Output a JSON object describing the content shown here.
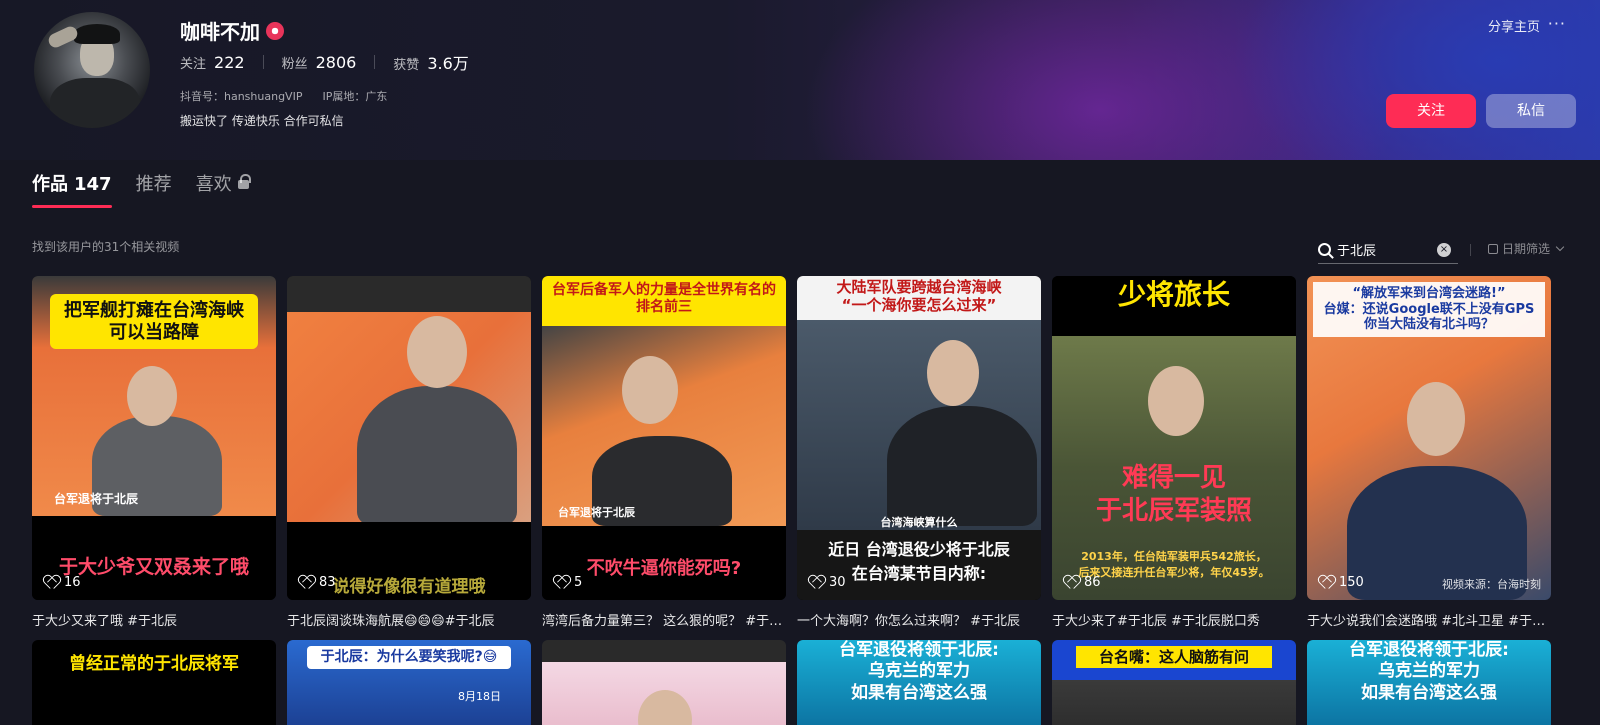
{
  "profile": {
    "name": "咖啡不加",
    "stats": [
      {
        "label": "关注",
        "value": "222"
      },
      {
        "label": "粉丝",
        "value": "2806"
      },
      {
        "label": "获赞",
        "value": "3.6万"
      }
    ],
    "douyin_id": "抖音号：hanshuangVIP",
    "ip": "IP属地：广东",
    "bio": "搬运快了 传递快乐 合作可私信",
    "share_label": "分享主页",
    "more_label": "···",
    "follow_label": "关注",
    "message_label": "私信"
  },
  "tabs": [
    {
      "label": "作品",
      "count": "147"
    },
    {
      "label": "推荐"
    },
    {
      "label": "喜欢"
    }
  ],
  "results_info": "找到该用户的31个相关视频",
  "search": {
    "value": "于北辰",
    "clear": "×"
  },
  "date_filter": "日期筛选",
  "videos": [
    {
      "top": "把军舰打瘫在台湾海峡\n可以当路障",
      "mid": "台军退将于北辰",
      "bottom": "于大少爷又双叒来了哦",
      "likes": "16",
      "title": "于大少又来了哦 #于北辰"
    },
    {
      "top": "",
      "mid": "",
      "bottom": "说得好像很有道理哦",
      "likes": "83",
      "title": "于北辰阔谈珠海航展😄😄😄#于北辰"
    },
    {
      "top": "台军后备军人的力量是全世界有名的\n排名前三",
      "mid": "台军退将于北辰",
      "bottom": "不吹牛逼你能死吗?",
      "likes": "5",
      "title": "湾湾后备力量第三？ 这么狠的呢？ #于北辰"
    },
    {
      "top": "大陆军队要跨越台湾海峡\n“一个海你要怎么过来”",
      "mid": "台湾海峡算什么",
      "bottom": "近日 台湾退役少将于北辰\n在台湾某节目内称:",
      "likes": "30",
      "title": "一个大海啊？你怎么过来啊？ #于北辰"
    },
    {
      "top": "少将旅长",
      "mid": "难得一见\n于北辰军装照",
      "bottom": "2013年，任台陆军装甲兵542旅长，\n后来又接连升任台军少将，年仅45岁。",
      "likes": "86",
      "title": "于大少来了#于北辰 #于北辰脱口秀"
    },
    {
      "top": "“解放军来到台湾会迷路!”\n台媒：还说Google联不上没有GPS\n你当大陆没有北斗吗？",
      "mid": "",
      "bottom": "",
      "likes": "150",
      "source": "视频来源：台海时刻",
      "title": "于大少说我们会迷路哦 #北斗卫星 #于北辰"
    }
  ],
  "videos_row2": [
    {
      "top": "曾经正常的于北辰将军"
    },
    {
      "top": "于北辰：为什么要笑我呢?😅",
      "date": "8月18日"
    },
    {
      "top": ""
    },
    {
      "top": "台军退役将领于北辰:\n乌克兰的军力\n如果有台湾这么强"
    },
    {
      "top": "台名嘴：这人脑筋有问"
    },
    {
      "top": "台军退役将领于北辰:\n乌克兰的军力\n如果有台湾这么强"
    }
  ],
  "colors": {
    "accent": "#fe2c55",
    "bg": "#161722"
  }
}
